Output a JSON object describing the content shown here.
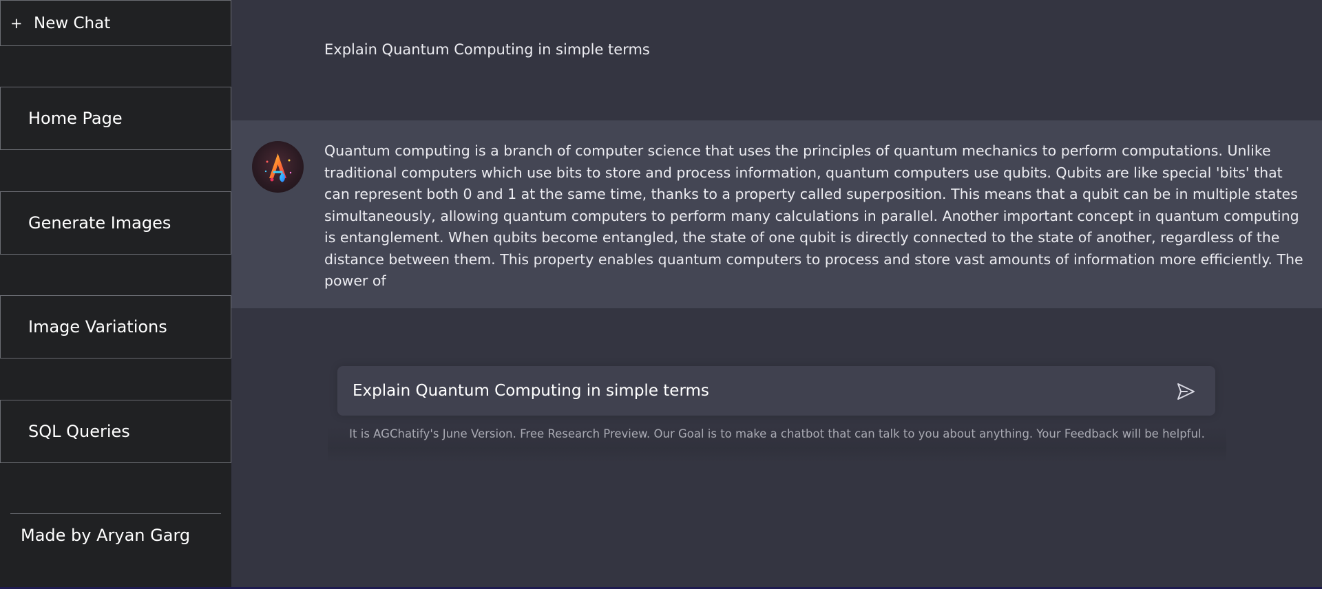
{
  "sidebar": {
    "new_chat_label": "New Chat",
    "new_chat_icon": "+",
    "items": [
      {
        "label": "Home Page"
      },
      {
        "label": "Generate Images"
      },
      {
        "label": "Image Variations"
      },
      {
        "label": "SQL Queries"
      }
    ],
    "footer": "Made by Aryan Garg"
  },
  "conversation": {
    "user_message": "Explain Quantum Computing in simple terms",
    "bot_message": "Quantum computing is a branch of computer science that uses the principles of quantum mechanics to perform computations. Unlike traditional computers which use bits to store and process information, quantum computers use qubits. Qubits are like special 'bits' that can represent both 0 and 1 at the same time, thanks to a property called superposition. This means that a qubit can be in multiple states simultaneously, allowing quantum computers to perform many calculations in parallel. Another important concept in quantum computing is entanglement. When qubits become entangled, the state of one qubit is directly connected to the state of another, regardless of the distance between them. This property enables quantum computers to process and store vast amounts of information more efficiently. The power of"
  },
  "input": {
    "value": "Explain Quantum Computing in simple terms",
    "placeholder": ""
  },
  "footer_note": "It is AGChatify's June Version. Free Research Preview. Our Goal is to make a chatbot that can talk to you about anything. Your Feedback will be helpful.",
  "colors": {
    "sidebar_bg": "#202123",
    "main_bg": "#343541",
    "bot_msg_bg": "#444654",
    "input_bg": "#40414f",
    "border": "#6b6d73"
  },
  "icons": {
    "avatar": "agchatify-logo-icon",
    "send": "send-icon",
    "new_chat": "plus-icon"
  }
}
